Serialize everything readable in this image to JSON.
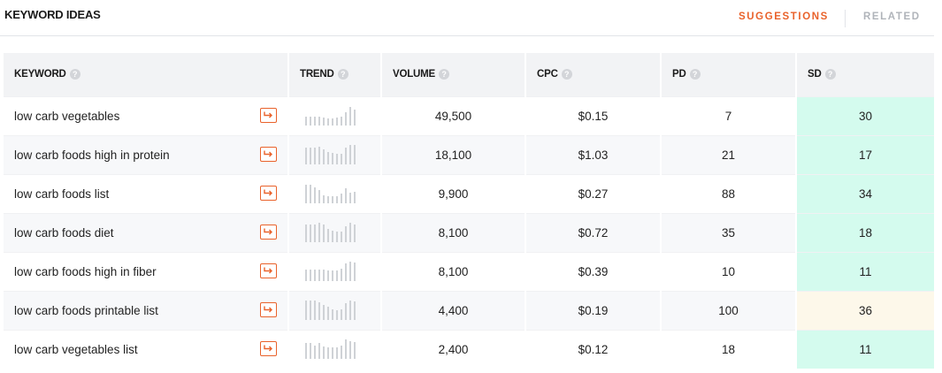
{
  "header": {
    "title": "KEYWORD IDEAS",
    "tabs": [
      {
        "label": "SUGGESTIONS",
        "active": true
      },
      {
        "label": "RELATED",
        "active": false
      }
    ],
    "accent_color": "#e9622b"
  },
  "table": {
    "columns": [
      "KEYWORD",
      "TREND",
      "VOLUME",
      "CPC",
      "PD",
      "SD"
    ],
    "help_icon": "question-circle-icon",
    "rows": [
      {
        "keyword": "low carb vegetables",
        "trend": [
          0.45,
          0.45,
          0.45,
          0.45,
          0.4,
          0.35,
          0.35,
          0.4,
          0.45,
          0.7,
          0.95,
          0.8
        ],
        "volume": "49,500",
        "cpc": "$0.15",
        "pd": "7",
        "sd": "30",
        "sd_level": "low"
      },
      {
        "keyword": "low carb foods high in protein",
        "trend": [
          0.85,
          0.85,
          0.85,
          0.9,
          0.75,
          0.65,
          0.6,
          0.55,
          0.55,
          0.85,
          1.0,
          1.0
        ],
        "volume": "18,100",
        "cpc": "$1.03",
        "pd": "21",
        "sd": "17",
        "sd_level": "low"
      },
      {
        "keyword": "low carb foods list",
        "trend": [
          0.95,
          0.95,
          0.8,
          0.7,
          0.4,
          0.35,
          0.35,
          0.35,
          0.5,
          0.75,
          0.55,
          0.6
        ],
        "volume": "9,900",
        "cpc": "$0.27",
        "pd": "88",
        "sd": "34",
        "sd_level": "low"
      },
      {
        "keyword": "low carb foods diet",
        "trend": [
          0.9,
          0.9,
          0.9,
          1.0,
          0.9,
          0.7,
          0.6,
          0.55,
          0.55,
          0.8,
          1.0,
          0.9
        ],
        "volume": "8,100",
        "cpc": "$0.72",
        "pd": "35",
        "sd": "18",
        "sd_level": "low"
      },
      {
        "keyword": "low carb foods high in fiber",
        "trend": [
          0.6,
          0.6,
          0.6,
          0.6,
          0.6,
          0.55,
          0.55,
          0.55,
          0.65,
          0.9,
          1.0,
          0.95
        ],
        "volume": "8,100",
        "cpc": "$0.39",
        "pd": "10",
        "sd": "11",
        "sd_level": "low"
      },
      {
        "keyword": "low carb foods printable list",
        "trend": [
          1.0,
          1.0,
          1.0,
          0.9,
          0.75,
          0.7,
          0.55,
          0.5,
          0.55,
          0.85,
          1.0,
          0.95
        ],
        "volume": "4,400",
        "cpc": "$0.19",
        "pd": "100",
        "sd": "36",
        "sd_level": "medium"
      },
      {
        "keyword": "low carb vegetables list",
        "trend": [
          0.8,
          0.8,
          0.7,
          0.8,
          0.65,
          0.6,
          0.6,
          0.6,
          0.7,
          1.0,
          0.9,
          0.85
        ],
        "volume": "2,400",
        "cpc": "$0.12",
        "pd": "18",
        "sd": "11",
        "sd_level": "low"
      }
    ]
  }
}
